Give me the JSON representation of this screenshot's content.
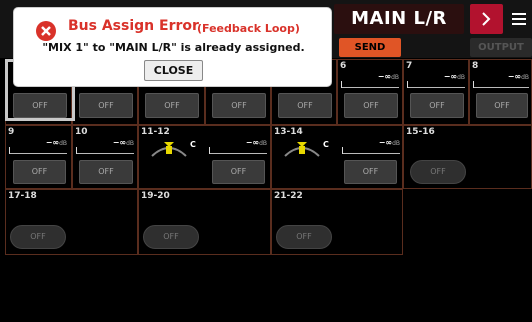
{
  "header": {
    "title": "MAIN L/R",
    "send_label": "SEND",
    "output_label": "OUTPUT"
  },
  "dialog": {
    "title": "Bus Assign Error",
    "subtitle": "(Feedback Loop)",
    "message": "\"MIX 1\" to \"MAIN L/R\" is already assigned.",
    "close_label": "CLOSE"
  },
  "rows": [
    {
      "cells": [
        {
          "label": "",
          "meter": null,
          "off": "OFF"
        },
        {
          "label": "",
          "meter": null,
          "off": "OFF"
        },
        {
          "label": "",
          "meter": null,
          "off": "OFF"
        },
        {
          "label": "",
          "meter": null,
          "off": "OFF"
        },
        {
          "label": "",
          "meter": null,
          "off": "OFF"
        },
        {
          "label": "6",
          "meter": "−∞",
          "unit": "dB",
          "off": "OFF"
        },
        {
          "label": "7",
          "meter": "−∞",
          "unit": "dB",
          "off": "OFF"
        },
        {
          "label": "8",
          "meter": "−∞",
          "unit": "dB",
          "off": "OFF"
        }
      ]
    },
    {
      "cells": [
        {
          "label": "9",
          "meter": "−∞",
          "unit": "dB",
          "off": "OFF"
        },
        {
          "label": "10",
          "meter": "−∞",
          "unit": "dB",
          "off": "OFF"
        },
        {
          "label": "11-12",
          "pan": "C",
          "meter": "−∞",
          "unit": "dB",
          "off": "OFF"
        },
        {
          "label": "13-14",
          "pan": "C",
          "meter": "−∞",
          "unit": "dB",
          "off": "OFF"
        },
        {
          "label": "15-16",
          "off": "OFF"
        }
      ]
    },
    {
      "cells": [
        {
          "label": "17-18",
          "off": "OFF"
        },
        {
          "label": "19-20",
          "off": "OFF"
        },
        {
          "label": "21-22",
          "off": "OFF"
        }
      ]
    }
  ]
}
